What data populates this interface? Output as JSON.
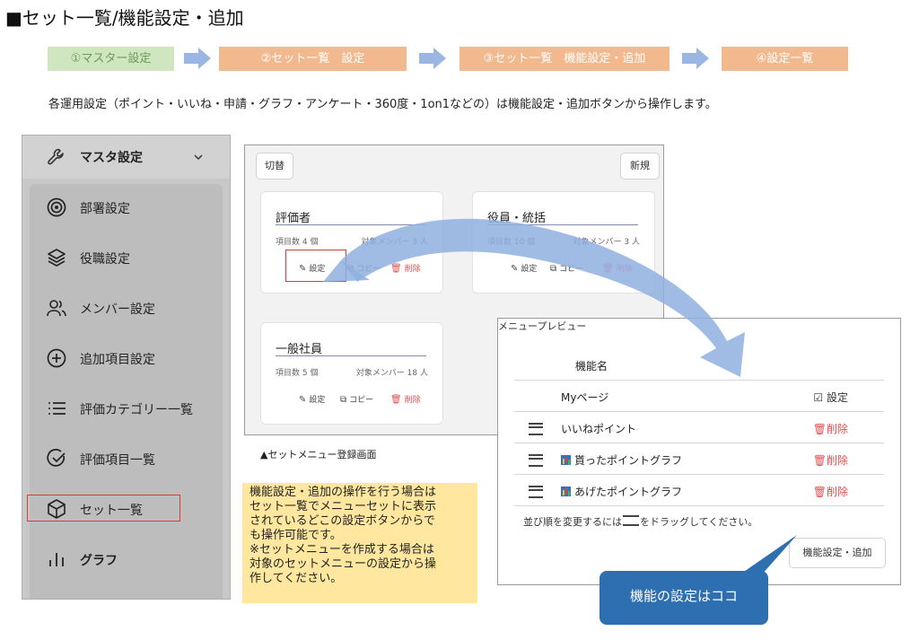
{
  "page_title": "■セット一覧/機能設定・追加",
  "steps": [
    {
      "label": "①マスター設定",
      "color": "#cfe6c1"
    },
    {
      "label": "②セット一覧　設定",
      "color": "#f3b98e"
    },
    {
      "label": "③セット一覧　機能設定・追加",
      "color": "#f3b98e"
    },
    {
      "label": "④設定一覧",
      "color": "#f3b98e"
    }
  ],
  "description": "各運用設定（ポイント・いいね・申請・グラフ・アンケート・360度・1on1などの）は機能設定・追加ボタンから操作します。",
  "sidebar": {
    "header": {
      "label": "マスタ設定",
      "icon": "wrench-icon",
      "chevron": "chevron-down-icon"
    },
    "items": [
      {
        "label": "部署設定",
        "icon": "target-icon"
      },
      {
        "label": "役職設定",
        "icon": "layers-icon"
      },
      {
        "label": "メンバー設定",
        "icon": "users-icon"
      },
      {
        "label": "追加項目設定",
        "icon": "plus-circle-icon"
      },
      {
        "label": "評価カテゴリー一覧",
        "icon": "list-icon"
      },
      {
        "label": "評価項目一覧",
        "icon": "check-circle-icon"
      },
      {
        "label": "セット一覧",
        "icon": "cube-icon"
      },
      {
        "label": "グラフ",
        "icon": "bar-chart-icon"
      }
    ]
  },
  "set_screen": {
    "switch_label": "切替",
    "new_label": "新規",
    "cards": [
      {
        "title": "評価者",
        "count": "項目数 4 個",
        "members": "対象メンバー 3 人",
        "settings": "設定",
        "copy": "コピー",
        "delete": "削除"
      },
      {
        "title": "役員・統括",
        "count": "項目数 10 個",
        "members": "対象メンバー 3 人",
        "settings": "設定",
        "copy": "コピー",
        "delete": "削除"
      },
      {
        "title": "一般社員",
        "count": "項目数 5 個",
        "members": "対象メンバー 18 人",
        "settings": "設定",
        "copy": "コピー",
        "delete": "削除"
      }
    ],
    "caption": "▲セットメニュー登録画面"
  },
  "note": [
    "機能設定・追加の操作を行う場合は",
    "セット一覧でメニューセットに表示",
    "されているどこの設定ボタンからで",
    "も操作可能です。",
    "※セットメニューを作成する場合は",
    "対象のセットメニューの設定から操",
    "作してください。"
  ],
  "preview": {
    "title": "メニュープレビュー",
    "column_header": "機能名",
    "rows": [
      {
        "name": "Myページ",
        "action": "設定",
        "draggable": false,
        "chart": false
      },
      {
        "name": "いいねポイント",
        "action": "削除",
        "draggable": true,
        "chart": false
      },
      {
        "name": "貰ったポイントグラフ",
        "action": "削除",
        "draggable": true,
        "chart": true
      },
      {
        "name": "あげたポイントグラフ",
        "action": "削除",
        "draggable": true,
        "chart": true
      }
    ],
    "hint_before": "並び順を変更するには",
    "hint_after": "をドラッグしてください。",
    "button_label": "機能設定・追加"
  },
  "callout": "機能の設定はココ",
  "colors": {
    "accent_blue": "#2d6fb0",
    "arrow_blue": "#9bb6e3",
    "delete_red": "#e05050",
    "highlight_red": "#d43c3c",
    "note_yellow": "#ffe79f"
  }
}
